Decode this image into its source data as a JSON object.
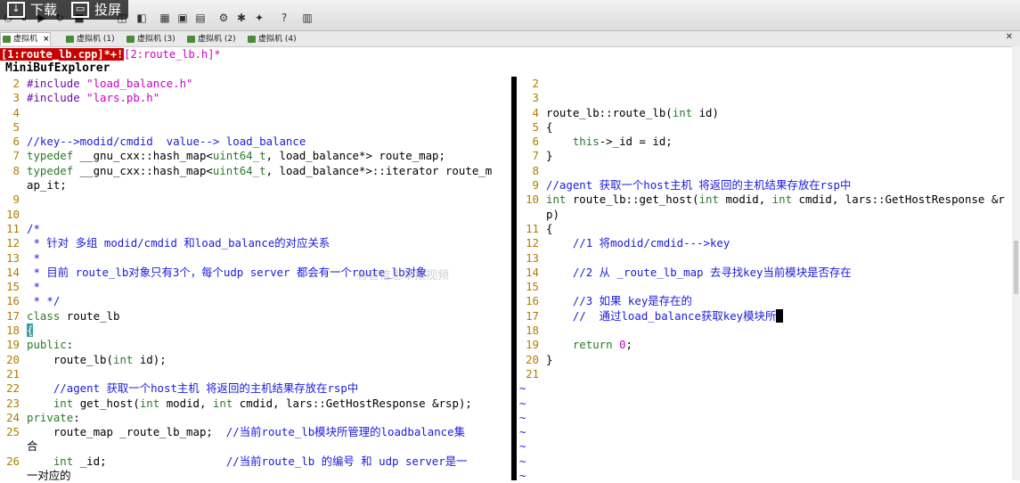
{
  "overlay": {
    "download_label": "下载",
    "cast_label": "投屏"
  },
  "vm_tabs": [
    {
      "label": "虚拟机",
      "active": true
    },
    {
      "label": "虚拟机 (1)"
    },
    {
      "label": "虚拟机 (3)"
    },
    {
      "label": "虚拟机 (2)"
    },
    {
      "label": "虚拟机 (4)"
    }
  ],
  "buffers": {
    "active": "[1:route_lb.cpp]*+!",
    "other": "[2:route_lb.h]*"
  },
  "minibuf_title": "MiniBufExplorer",
  "watermark": "有害信息举报视频",
  "left_lines": [
    {
      "n": "2",
      "t": "#include \"load_balance.h\""
    },
    {
      "n": "3",
      "t": "#include \"lars.pb.h\""
    },
    {
      "n": "4",
      "t": ""
    },
    {
      "n": "5",
      "t": ""
    },
    {
      "n": "6",
      "t": "//key-->modid/cmdid  value--> load_balance"
    },
    {
      "n": "7",
      "t": "typedef __gnu_cxx::hash_map<uint64_t, load_balance*> route_map;"
    },
    {
      "n": "8",
      "t": "typedef __gnu_cxx::hash_map<uint64_t, load_balance*>::iterator route_m"
    },
    {
      "n": "",
      "t": "ap_it;"
    },
    {
      "n": "9",
      "t": ""
    },
    {
      "n": "10",
      "t": ""
    },
    {
      "n": "11",
      "t": "/*"
    },
    {
      "n": "12",
      "t": " * 针对 多组 modid/cmdid 和load_balance的对应关系"
    },
    {
      "n": "13",
      "t": " *"
    },
    {
      "n": "14",
      "t": " * 目前 route_lb对象只有3个，每个udp server 都会有一个route_lb对象"
    },
    {
      "n": "15",
      "t": " *"
    },
    {
      "n": "16",
      "t": " * */"
    },
    {
      "n": "17",
      "t": "class route_lb"
    },
    {
      "n": "18",
      "t": "{"
    },
    {
      "n": "19",
      "t": "public:"
    },
    {
      "n": "20",
      "t": "    route_lb(int id);"
    },
    {
      "n": "21",
      "t": ""
    },
    {
      "n": "22",
      "t": "    //agent 获取一个host主机 将返回的主机结果存放在rsp中"
    },
    {
      "n": "23",
      "t": "    int get_host(int modid, int cmdid, lars::GetHostResponse &rsp);"
    },
    {
      "n": "24",
      "t": "private:"
    },
    {
      "n": "25",
      "t": "    route_map _route_lb_map;  //当前route_lb模块所管理的loadbalance集"
    },
    {
      "n": "",
      "t": "合"
    },
    {
      "n": "26",
      "t": "    int _id;                  //当前route_lb 的编号 和 udp server是一"
    },
    {
      "n": "",
      "t": "一对应的"
    }
  ],
  "right_lines": [
    {
      "n": "2",
      "t": ""
    },
    {
      "n": "3",
      "t": ""
    },
    {
      "n": "4",
      "t": "route_lb::route_lb(int id)"
    },
    {
      "n": "5",
      "t": "{"
    },
    {
      "n": "6",
      "t": "    this->_id = id;"
    },
    {
      "n": "7",
      "t": "}"
    },
    {
      "n": "8",
      "t": ""
    },
    {
      "n": "9",
      "t": "//agent 获取一个host主机 将返回的主机结果存放在rsp中"
    },
    {
      "n": "10",
      "t": "int route_lb::get_host(int modid, int cmdid, lars::GetHostResponse &r"
    },
    {
      "n": "",
      "t": "p)"
    },
    {
      "n": "11",
      "t": "{"
    },
    {
      "n": "12",
      "t": "    //1 将modid/cmdid--->key"
    },
    {
      "n": "13",
      "t": ""
    },
    {
      "n": "14",
      "t": "    //2 从 _route_lb_map 去寻找key当前模块是否存在"
    },
    {
      "n": "15",
      "t": ""
    },
    {
      "n": "16",
      "t": "    //3 如果 key是存在的"
    },
    {
      "n": "17",
      "t": "    //  通过load_balance获取key模块所"
    },
    {
      "n": "18",
      "t": ""
    },
    {
      "n": "19",
      "t": "    return 0;"
    },
    {
      "n": "20",
      "t": "}"
    },
    {
      "n": "21",
      "t": ""
    }
  ],
  "tildes": [
    "~",
    "~",
    "~",
    "~",
    "~",
    "~",
    "~"
  ],
  "colors": {
    "active_buffer_bg": "#c80000",
    "line_number": "#b07d00",
    "comment": "#1a1ae0",
    "keyword": "#2a7a2a"
  }
}
